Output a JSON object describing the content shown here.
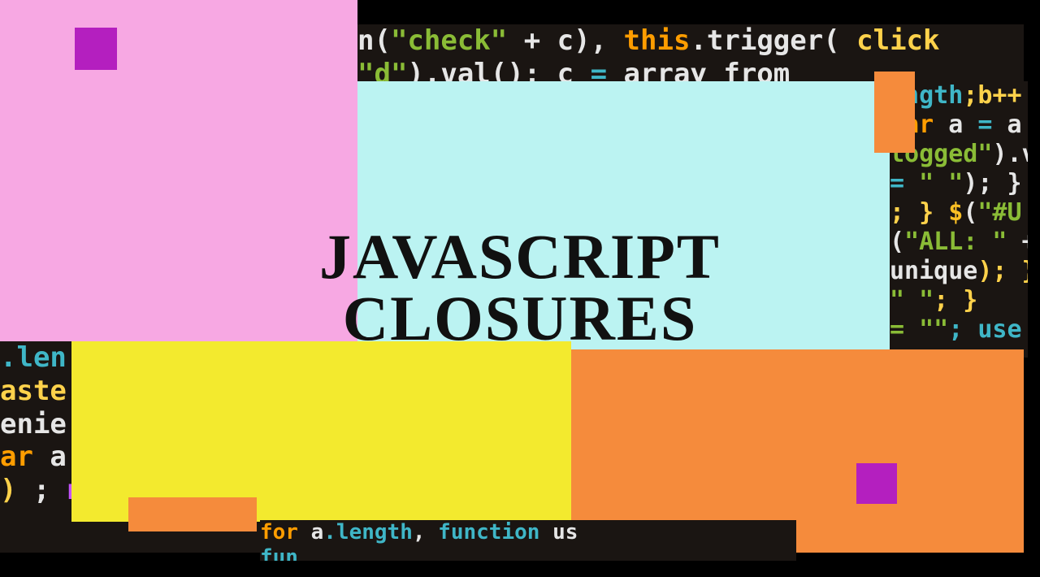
{
  "title_line1": "JAVASCRIPT",
  "title_line2": "CLOSURES",
  "code_top_lines": [
    {
      "segments": [
        {
          "t": "n(",
          "c": "tok-n"
        },
        {
          "t": "\"check\"",
          "c": "tok-s"
        },
        {
          "t": " + c), ",
          "c": "tok-n"
        },
        {
          "t": "this",
          "c": "tok-k"
        },
        {
          "t": ".trigger( ",
          "c": "tok-n"
        },
        {
          "t": "click",
          "c": "tok-y"
        }
      ]
    },
    {
      "segments": [
        {
          "t": "            \"d\"",
          "c": "tok-s"
        },
        {
          "t": ").val();   c ",
          "c": "tok-n"
        },
        {
          "t": "= ",
          "c": "tok-b"
        },
        {
          "t": "array_from_",
          "c": "tok-n"
        }
      ]
    }
  ],
  "code_right_lines": [
    {
      "segments": [
        {
          "t": "ength",
          "c": "tok-b"
        },
        {
          "t": ";b++",
          "c": "tok-y"
        }
      ]
    },
    {
      "segments": [
        {
          "t": "var ",
          "c": "tok-k"
        },
        {
          "t": "a ",
          "c": "tok-n"
        },
        {
          "t": "= ",
          "c": "tok-b"
        },
        {
          "t": "a",
          "c": "tok-n"
        }
      ]
    },
    {
      "segments": [
        {
          "t": "logged\"",
          "c": "tok-s"
        },
        {
          "t": ").va",
          "c": "tok-n"
        }
      ]
    },
    {
      "segments": [
        {
          "t": "= ",
          "c": "tok-b"
        },
        {
          "t": "\" \"",
          "c": "tok-s"
        },
        {
          "t": "); }",
          "c": "tok-n"
        }
      ]
    },
    {
      "segments": [
        {
          "t": "; } ",
          "c": "tok-y"
        },
        {
          "t": "$",
          "c": "tok-dollar"
        },
        {
          "t": "(",
          "c": "tok-n"
        },
        {
          "t": "\"#U",
          "c": "tok-s"
        }
      ]
    },
    {
      "segments": [
        {
          "t": "(",
          "c": "tok-n"
        },
        {
          "t": "\"ALL: \"",
          "c": "tok-s"
        },
        {
          "t": " +",
          "c": "tok-n"
        }
      ]
    },
    {
      "segments": [
        {
          "t": "unique",
          "c": "tok-n"
        },
        {
          "t": "); }",
          "c": "tok-y"
        },
        {
          "t": ").",
          "c": "tok-n"
        }
      ]
    },
    {
      "segments": [
        {
          "t": "\"   \"",
          "c": "tok-s"
        },
        {
          "t": ";  }",
          "c": "tok-y"
        }
      ]
    },
    {
      "segments": [
        {
          "t": " = \"\"",
          "c": "tok-s"
        },
        {
          "t": "; use",
          "c": "tok-b"
        }
      ]
    }
  ],
  "code_left_lines": [
    {
      "segments": [
        {
          "t": ".len",
          "c": "tok-b"
        }
      ]
    },
    {
      "segments": [
        {
          "t": "aste",
          "c": "tok-y"
        }
      ]
    },
    {
      "segments": [
        {
          "t": "enie",
          "c": "tok-n"
        }
      ]
    },
    {
      "segments": [
        {
          "t": "ar ",
          "c": "tok-k"
        },
        {
          "t": "a",
          "c": "tok-n"
        }
      ]
    },
    {
      "segments": [
        {
          "t": ") ",
          "c": "tok-y"
        },
        {
          "t": "; ",
          "c": "tok-n"
        },
        {
          "t": "n(){",
          "c": "tok-d"
        }
      ]
    }
  ],
  "code_bottom_lines": [
    {
      "segments": [
        {
          "t": " for          ",
          "c": "tok-k"
        },
        {
          "t": "a",
          "c": "tok-n"
        },
        {
          "t": ".length",
          "c": "tok-b"
        },
        {
          "t": ", ",
          "c": "tok-n"
        },
        {
          "t": "function ",
          "c": "tok-b"
        },
        {
          "t": "us",
          "c": "tok-n"
        }
      ]
    },
    {
      "segments": [
        {
          "t": "                              fun",
          "c": "tok-b"
        }
      ]
    }
  ]
}
